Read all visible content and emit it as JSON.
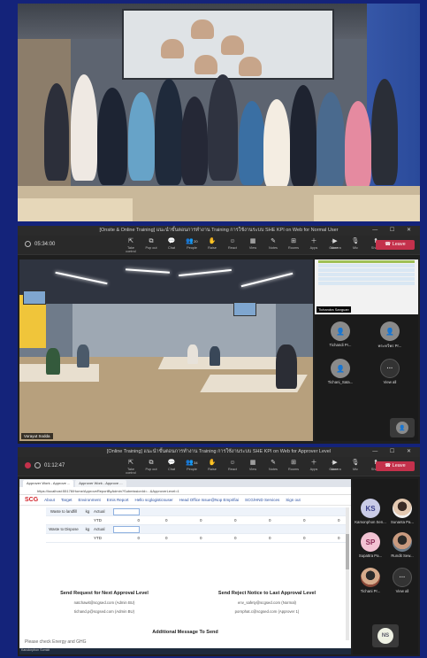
{
  "meeting2": {
    "title": "[Onsite & Online Training] แนะนำขั้นตอนการทำงาน Training การใช้งานระบบ SHE KPI on Web for Normal User",
    "timer": "05:34:00",
    "tools": [
      "Take control",
      "Pop out",
      "Chat",
      "People",
      "Raise",
      "React",
      "View",
      "Notes",
      "Rooms",
      "Apps",
      "More"
    ],
    "people_count": "20",
    "right_tools": [
      "Camera",
      "Mic",
      "Share"
    ],
    "leave_label": "Leave",
    "video_name": "Vorayut Sodda",
    "share_label": "Tichandra Sanguan",
    "participants": [
      {
        "name": "Tichandi Pr...",
        "avatar": "gray"
      },
      {
        "name": "พระทวีพร Pr...",
        "avatar": "gray"
      },
      {
        "name": "Tichani_Sata...",
        "avatar": "gray"
      },
      {
        "name": "View all",
        "avatar": "more"
      }
    ]
  },
  "meeting3": {
    "title": "[Online Training] แนะนำขั้นตอนการทำงาน Training การใช้งานระบบ SHE KPI on Web for Approver Level",
    "timer": "01:12:47",
    "tools": [
      "Take control",
      "Pop out",
      "Chat",
      "People",
      "Raise",
      "React",
      "View",
      "Notes",
      "Rooms",
      "Apps",
      "More"
    ],
    "people_count": "34",
    "right_tools": [
      "Camera",
      "Mic",
      "Share"
    ],
    "leave_label": "Leave",
    "browser": {
      "tabs": [
        "Approver Work - Approve ...",
        "Approver Work - Approve ..."
      ],
      "url": "https://localhost:55178/Home/ApproveReportByAdmin?SubmissionId=...&ApproverLevel=1",
      "logo": "SCG",
      "nav": [
        "About",
        "Target",
        "Environment",
        "Emis Report",
        "Hello scglogisticsuser",
        "Head Office Issue@Nop Emprifiai",
        "SCG/HND Services",
        "Sign out"
      ],
      "rows": [
        {
          "label": "Waste to landfill",
          "unit": "kg",
          "kind": "Actual",
          "values": [
            "",
            "",
            "",
            "",
            "",
            ""
          ]
        },
        {
          "label": "",
          "unit": "",
          "kind": "YTD",
          "values": [
            "0",
            "0",
            "0",
            "0",
            "0",
            "0"
          ]
        },
        {
          "label": "Waste to Dispose",
          "unit": "kg",
          "kind": "Actual",
          "values": [
            "",
            "",
            "",
            "",
            "",
            ""
          ]
        },
        {
          "label": "",
          "unit": "",
          "kind": "YTD",
          "values": [
            "0",
            "0",
            "0",
            "0",
            "0",
            "0"
          ]
        }
      ],
      "send_next_title": "Send Request for Next Approval Level",
      "send_next_emails": [
        "natchawit@scgsed.com (Admin BU)",
        "tichand.p@scgsed.com (Admin BU)"
      ],
      "reject_title": "Send Reject Notice to Last Approval Level",
      "reject_emails": [
        "env_safety@scgsed.com (Normal)",
        "pornphat.c@scgsed.com (Approver 1)"
      ],
      "additional_title": "Additional Message To Send",
      "message": "Please check Energy and GHG",
      "taskbar_text": "Kanoknphon Somkit"
    },
    "participants": [
      {
        "name": "Kamonphon Sen...",
        "avatar": "ks",
        "initials": "KS"
      },
      {
        "name": "Sunanta Pa...",
        "avatar": "photo1",
        "initials": ""
      },
      {
        "name": "Supattra Pa...",
        "avatar": "sp",
        "initials": "SP"
      },
      {
        "name": "Rundit Sew...",
        "avatar": "photo2",
        "initials": ""
      },
      {
        "name": "Tichani Pr...",
        "avatar": "photo3",
        "initials": ""
      },
      {
        "name": "View all",
        "avatar": "more",
        "initials": "···"
      }
    ],
    "self_initials": "NS"
  }
}
